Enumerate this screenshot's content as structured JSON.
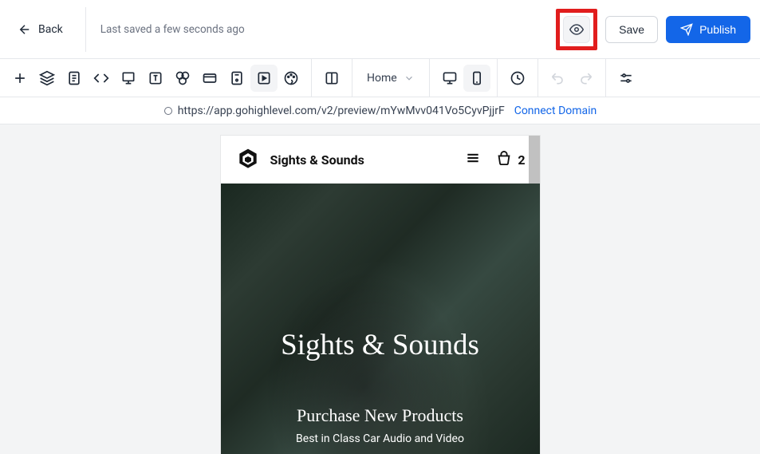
{
  "header": {
    "back_label": "Back",
    "save_status": "Last saved a few seconds ago",
    "save_label": "Save",
    "publish_label": "Publish"
  },
  "toolbar": {
    "page_label": "Home"
  },
  "urlbar": {
    "url": "https://app.gohighlevel.com/v2/preview/mYwMvv041Vo5CyvPjjrF",
    "connect_label": "Connect Domain"
  },
  "preview": {
    "site_title": "Sights & Sounds",
    "cart_count": "2",
    "hero_title": "Sights & Sounds",
    "hero_sub1": "Purchase New Products",
    "hero_sub2": "Best in Class Car Audio and Video"
  }
}
